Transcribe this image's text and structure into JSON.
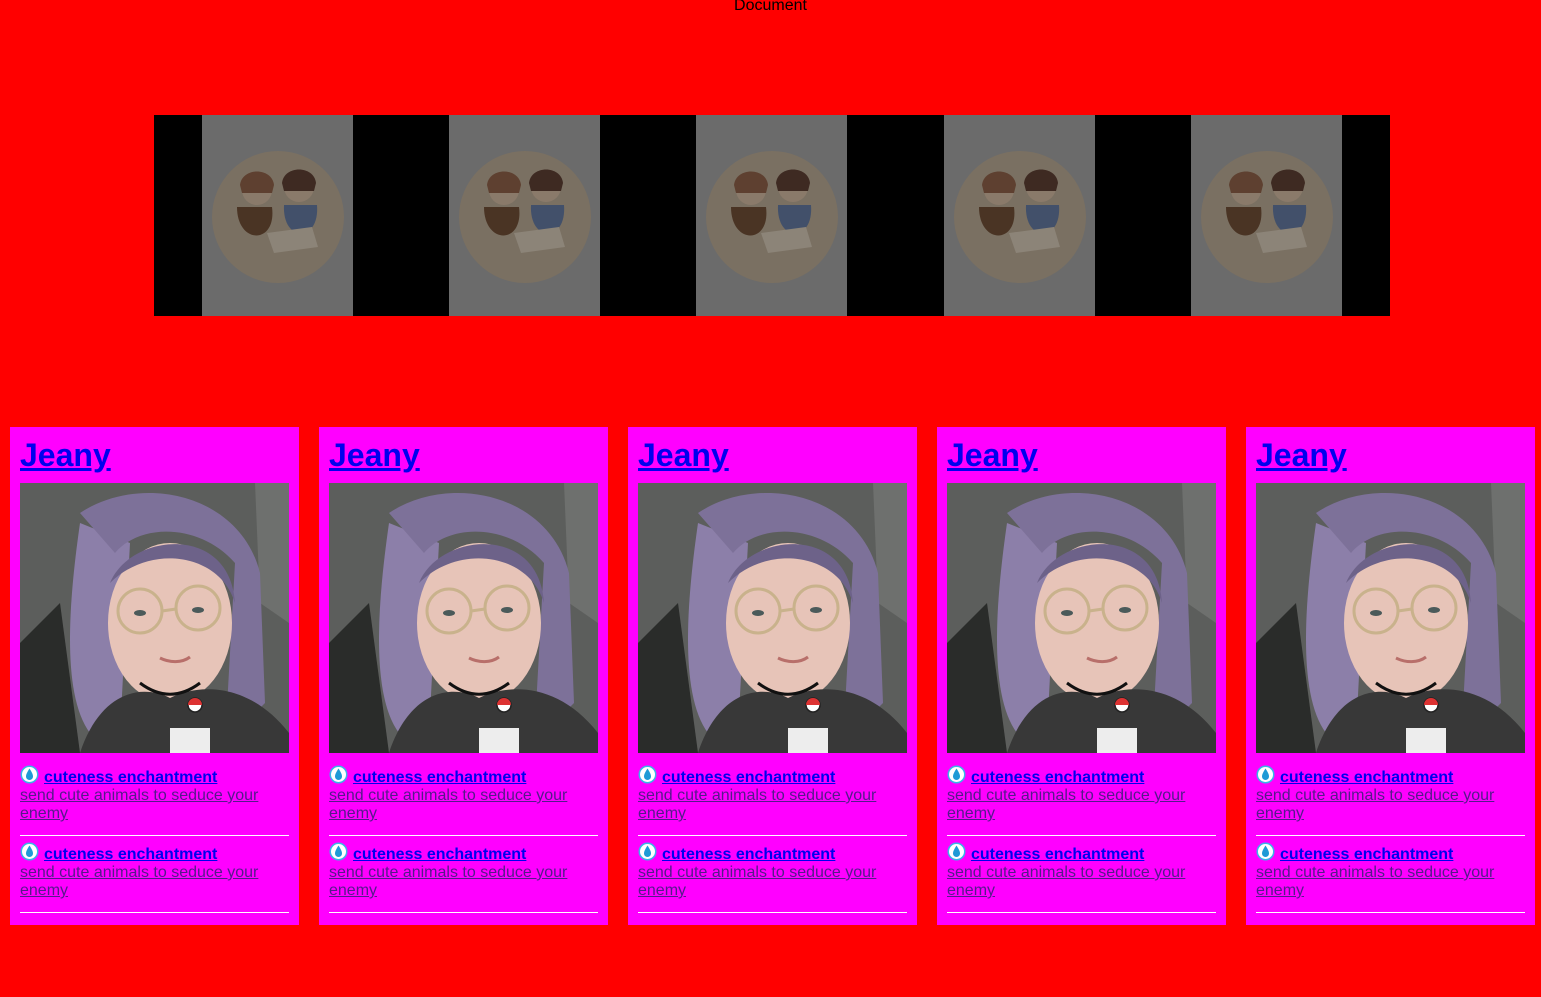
{
  "page": {
    "title": "Document",
    "background": "#ff0000"
  },
  "gallery": {
    "thumbnails": [
      {
        "alt": "chibi-couple-thumbnail"
      },
      {
        "alt": "chibi-couple-thumbnail"
      },
      {
        "alt": "chibi-couple-thumbnail"
      },
      {
        "alt": "chibi-couple-thumbnail"
      },
      {
        "alt": "chibi-couple-thumbnail"
      }
    ]
  },
  "cards": [
    {
      "name": "Jeany",
      "spells": [
        {
          "icon": "water-drop-icon",
          "title": "cuteness enchantment",
          "description": "send cute animals to seduce your enemy"
        },
        {
          "icon": "water-drop-icon",
          "title": "cuteness enchantment",
          "description": "send cute animals to seduce your enemy"
        }
      ]
    },
    {
      "name": "Jeany",
      "spells": [
        {
          "icon": "water-drop-icon",
          "title": "cuteness enchantment",
          "description": "send cute animals to seduce your enemy"
        },
        {
          "icon": "water-drop-icon",
          "title": "cuteness enchantment",
          "description": "send cute animals to seduce your enemy"
        }
      ]
    },
    {
      "name": "Jeany",
      "spells": [
        {
          "icon": "water-drop-icon",
          "title": "cuteness enchantment",
          "description": "send cute animals to seduce your enemy"
        },
        {
          "icon": "water-drop-icon",
          "title": "cuteness enchantment",
          "description": "send cute animals to seduce your enemy"
        }
      ]
    },
    {
      "name": "Jeany",
      "spells": [
        {
          "icon": "water-drop-icon",
          "title": "cuteness enchantment",
          "description": "send cute animals to seduce your enemy"
        },
        {
          "icon": "water-drop-icon",
          "title": "cuteness enchantment",
          "description": "send cute animals to seduce your enemy"
        }
      ]
    },
    {
      "name": "Jeany",
      "spells": [
        {
          "icon": "water-drop-icon",
          "title": "cuteness enchantment",
          "description": "send cute animals to seduce your enemy"
        },
        {
          "icon": "water-drop-icon",
          "title": "cuteness enchantment",
          "description": "send cute animals to seduce your enemy"
        }
      ]
    }
  ],
  "colors": {
    "card": "#ff00ff",
    "link": "#0000ee",
    "visited_link": "#551a8b",
    "strip": "#000000"
  }
}
